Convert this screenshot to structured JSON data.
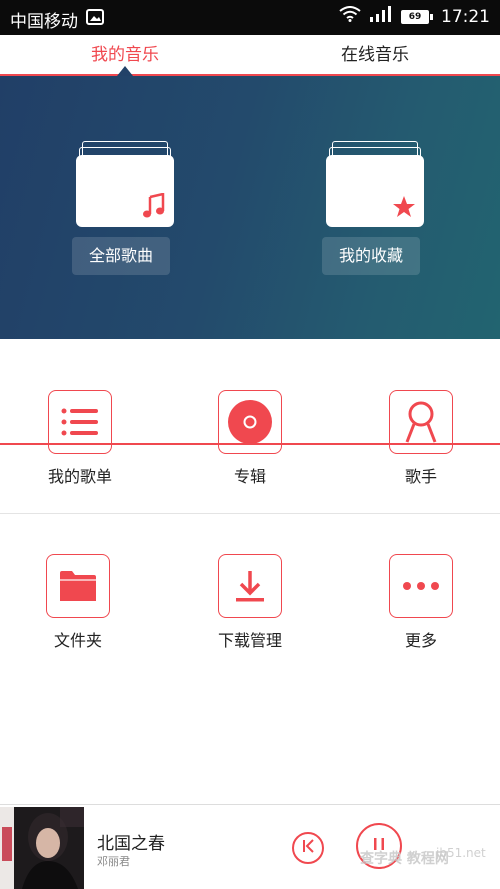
{
  "status_bar": {
    "carrier": "中国移动",
    "battery": "69",
    "time": "17:21"
  },
  "tabs": [
    {
      "label": "我的音乐"
    },
    {
      "label": "在线音乐"
    }
  ],
  "hero": [
    {
      "label": "全部歌曲",
      "icon": "music-note-icon"
    },
    {
      "label": "我的收藏",
      "icon": "star-icon"
    }
  ],
  "grid": [
    {
      "label": "我的歌单",
      "icon": "list-icon"
    },
    {
      "label": "专辑",
      "icon": "album-disc-icon"
    },
    {
      "label": "歌手",
      "icon": "singer-icon"
    },
    {
      "label": "文件夹",
      "icon": "folder-icon"
    },
    {
      "label": "下载管理",
      "icon": "download-icon"
    },
    {
      "label": "更多",
      "icon": "more-icon"
    }
  ],
  "player": {
    "title": "北国之春",
    "artist": "邓丽君"
  },
  "watermark": {
    "text": "查字典 教程网",
    "site": "jb51.net"
  },
  "colors": {
    "accent": "#f0484f",
    "hero_start": "#213f67",
    "hero_end": "#226470"
  }
}
